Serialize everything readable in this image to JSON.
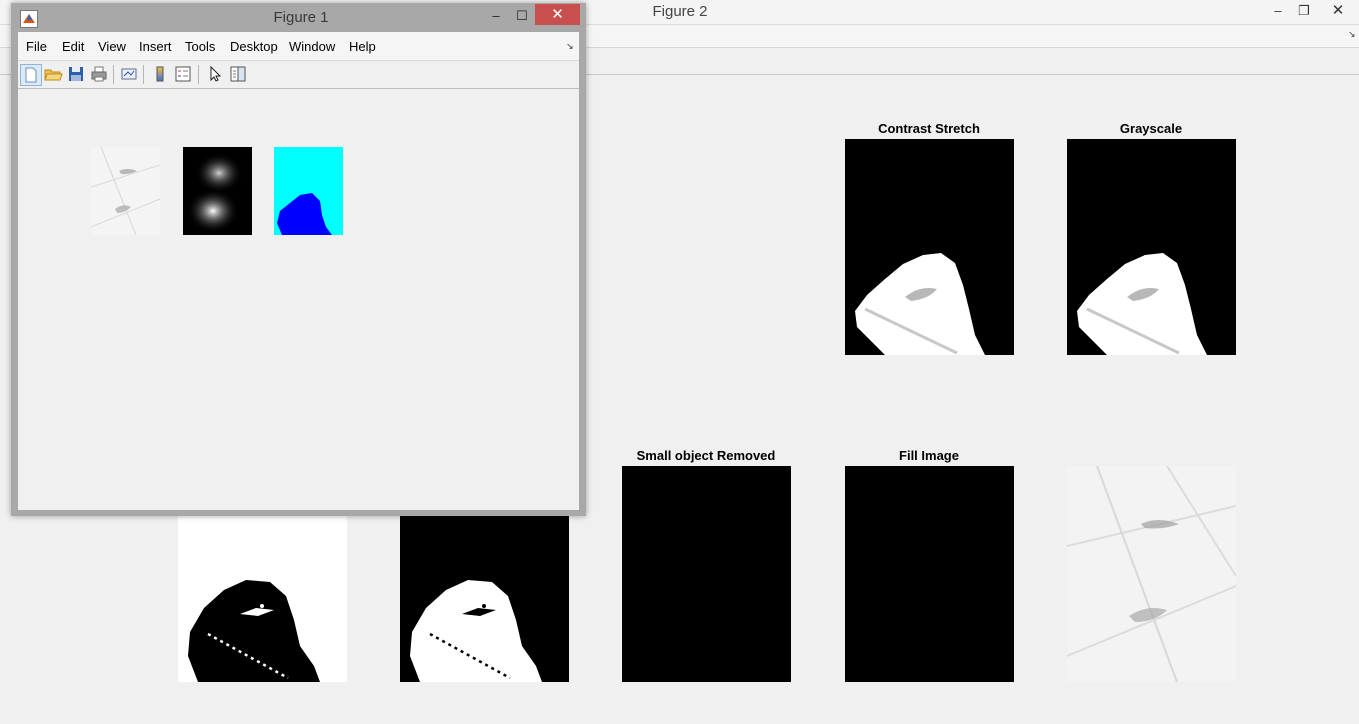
{
  "figure2": {
    "title": "Figure 2",
    "controls": {
      "minimize": "–",
      "maximize": "❐",
      "close": "✕"
    },
    "plots": [
      {
        "title": "Contrast Stretch",
        "content": "white-blob-on-black"
      },
      {
        "title": "Grayscale",
        "content": "white-blob-on-black"
      },
      {
        "title": "",
        "content": "black-blob-on-white"
      },
      {
        "title": "",
        "content": "white-blob-on-black-dotted"
      },
      {
        "title": "Small object Removed",
        "content": "all-black"
      },
      {
        "title": "Fill Image",
        "content": "all-black"
      },
      {
        "title": "",
        "content": "original-photo"
      }
    ]
  },
  "figure1": {
    "title": "Figure 1",
    "controls": {
      "minimize": "–",
      "maximize": "☐",
      "close": "✕"
    },
    "menu": [
      "File",
      "Edit",
      "View",
      "Insert",
      "Tools",
      "Desktop",
      "Window",
      "Help"
    ],
    "toolbar": [
      "new-figure-icon",
      "open-file-icon",
      "save-icon",
      "print-icon",
      "link-plot-icon",
      "colorbar-icon",
      "legend-icon",
      "pointer-icon",
      "property-editor-icon"
    ],
    "thumbnails": [
      "original-photo",
      "blurred-grayscale",
      "cyan-blue-segmentation"
    ]
  },
  "colors": {
    "close_red": "#c7504f",
    "cyan": "#00ffff",
    "blue": "#0000ff"
  }
}
